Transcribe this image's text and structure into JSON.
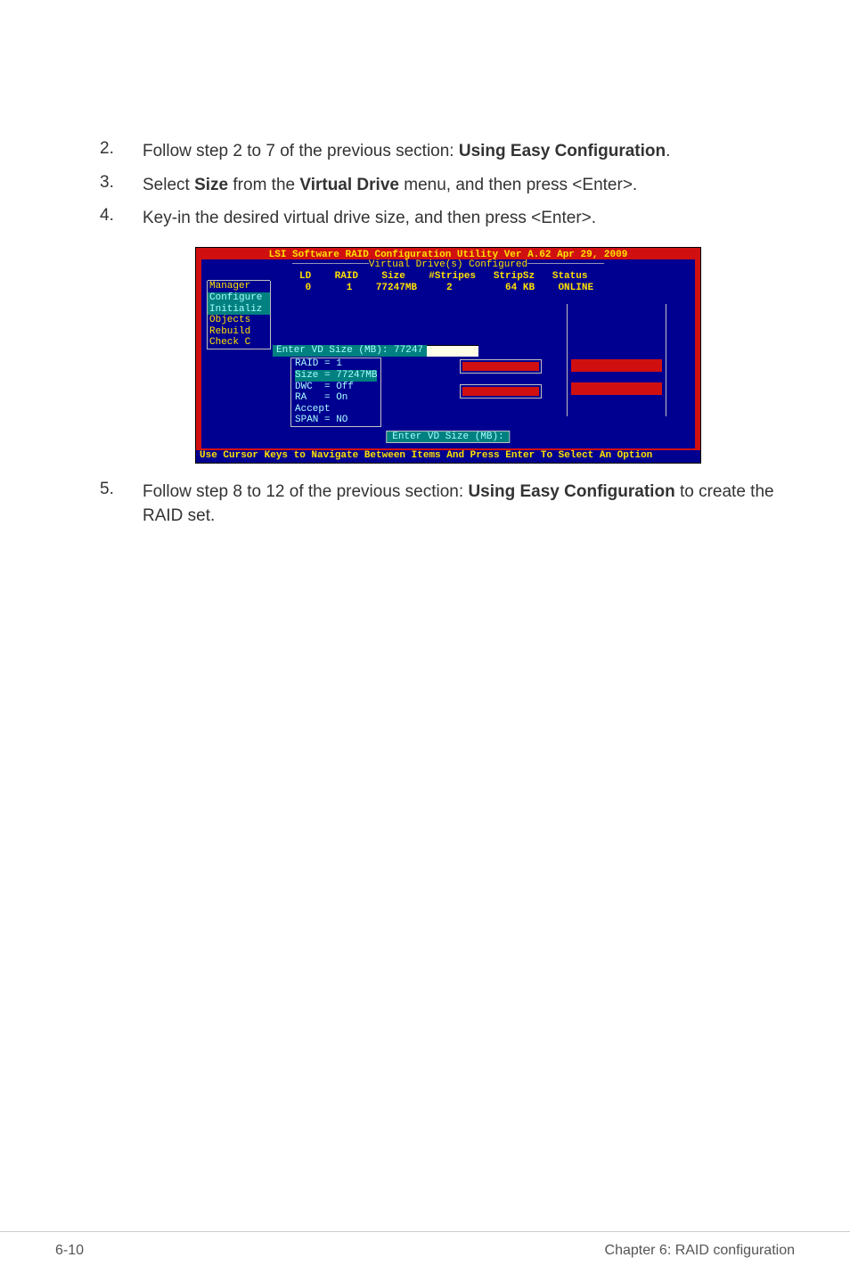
{
  "steps": {
    "s2": {
      "num": "2.",
      "pre": "Follow step 2 to 7 of the previous section: ",
      "bold1": "Using Easy Configuration",
      "post": "."
    },
    "s3": {
      "num": "3.",
      "pre": "Select ",
      "bold1": "Size",
      "mid": " from the ",
      "bold2": "Virtual Drive",
      "post": " menu, and then press <Enter>."
    },
    "s4": {
      "num": "4.",
      "text": "Key-in the desired virtual drive size, and then press <Enter>."
    },
    "s5": {
      "num": "5.",
      "pre": "Follow step 8 to 12 of the previous section: ",
      "bold1": "Using Easy Configuration",
      "post": " to create the RAID set."
    }
  },
  "screenshot": {
    "title": "LSI Software RAID Configuration Utility Ver A.62 Apr 29, 2009",
    "header_label": "Virtual Drive(s) Configured",
    "cols_line1": "LD    RAID    Size    #Stripes   StripSz   Status",
    "cols_line2": " 0      1    77247MB     2         64 KB    ONLINE",
    "side_menu": {
      "manager": "Manager",
      "configure": "Configure",
      "initialize": "Initializ",
      "objects": "Objects",
      "rebuild": "Rebuild",
      "check": "Check C"
    },
    "enter_vd_row": "Enter VD Size (MB): 77247",
    "vd_props": {
      "raid": "RAID = 1",
      "size": "Size = 77247MB",
      "dwc": "DWC  = Off",
      "ra": "RA   = On",
      "accept": "Accept",
      "span": "SPAN = NO"
    },
    "bottom_label": "Enter VD Size (MB):",
    "footer": "Use Cursor Keys to Navigate Between Items And Press Enter To Select An Option"
  },
  "footer": {
    "left": "6-10",
    "right": "Chapter 6: RAID configuration"
  }
}
